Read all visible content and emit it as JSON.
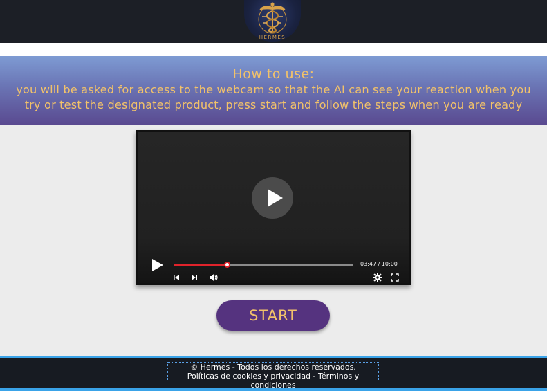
{
  "header": {
    "logo_text": "HERMES",
    "logo_icon": "caduceus-icon"
  },
  "banner": {
    "title": "How to use:",
    "text": "you will be asked for access to the webcam so that the AI can see your reaction when you try or test the designated product, press start and follow the steps when you are ready"
  },
  "player": {
    "play_icon": "play-icon",
    "progress": 0.295,
    "time": "03:47 / 10:00",
    "icons": [
      "play-icon",
      "previous-icon",
      "next-icon",
      "volume-icon",
      "settings-icon",
      "fullscreen-icon"
    ]
  },
  "start": {
    "label": "START"
  },
  "footer": {
    "copyright": "© Hermes - Todos los derechos reservados.",
    "cookies_link": "Políticas de cookies y privacidad",
    "separator": " - ",
    "terms_link": "Términos y condiciones"
  },
  "colors": {
    "accent_gold": "#f2c26a",
    "button_purple": "#55337f",
    "progress_red": "#e0232b",
    "footer_blue": "#3aa3e8"
  }
}
